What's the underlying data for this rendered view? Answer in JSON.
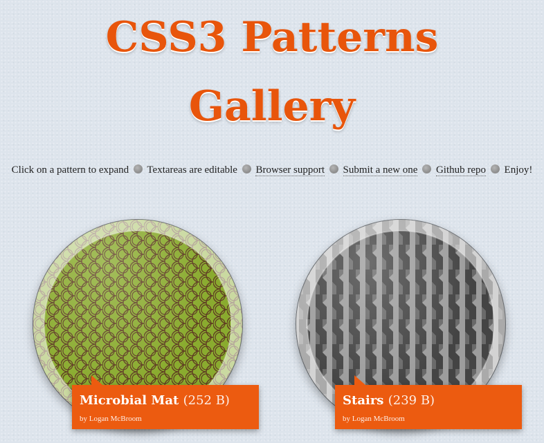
{
  "title": {
    "line1": "CSS3 Patterns",
    "line2": "Gallery"
  },
  "intro": {
    "click_text": "Click on a pattern to expand",
    "textareas_text": "Textareas are editable",
    "browser_support_link": "Browser support",
    "submit_link": "Submit a new one",
    "github_link": "Github repo",
    "enjoy_text": "Enjoy!"
  },
  "patterns": [
    {
      "name": "Microbial Mat",
      "size": "(252 B)",
      "author": "by Logan McBroom",
      "colors": {
        "base": "#8aab2f",
        "line": "#5e3b22"
      },
      "icon": "microbial-mat-swatch"
    },
    {
      "name": "Stairs",
      "size": "(239 B)",
      "author": "by Logan McBroom",
      "colors": {
        "base": "#6a6a6a",
        "dark": "#444444",
        "light": "#9d9d9d"
      },
      "icon": "stairs-swatch"
    }
  ],
  "colors": {
    "accent": "#e8550b",
    "label_bg": "#ec5b10",
    "background": "#dde4ec"
  }
}
